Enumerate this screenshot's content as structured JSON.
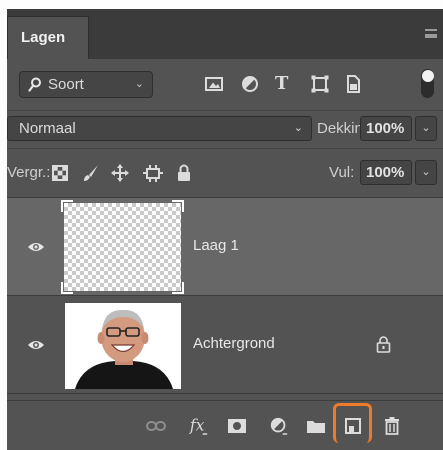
{
  "panel": {
    "tab_label": "Lagen"
  },
  "filter": {
    "kind_label": "Soort",
    "icons": [
      "pixel-filter-icon",
      "adjustment-filter-icon",
      "type-filter-icon",
      "shape-filter-icon",
      "smart-object-filter-icon"
    ],
    "toggle": "on"
  },
  "blend": {
    "mode": "Normaal",
    "opacity_label": "Dekking:",
    "opacity_value": "100%"
  },
  "lock": {
    "label": "Vergr.:",
    "fill_label": "Vul:",
    "fill_value": "100%"
  },
  "layers": [
    {
      "name": "Laag 1",
      "visible": true,
      "selected": true,
      "locked": false,
      "thumbnail": "transparent"
    },
    {
      "name": "Achtergrond",
      "visible": true,
      "selected": false,
      "locked": true,
      "thumbnail": "photo"
    }
  ],
  "bottom_bar": {
    "icons": [
      "link-icon",
      "fx-icon",
      "mask-icon",
      "adjustment-layer-icon",
      "folder-icon",
      "new-layer-icon",
      "trash-icon"
    ],
    "highlighted": "new-layer-icon",
    "highlight_color": "#ef7a2a"
  },
  "colors": {
    "panel": "#535353",
    "header": "#3b3b3b",
    "selected_row": "#676767",
    "field": "#454545"
  }
}
